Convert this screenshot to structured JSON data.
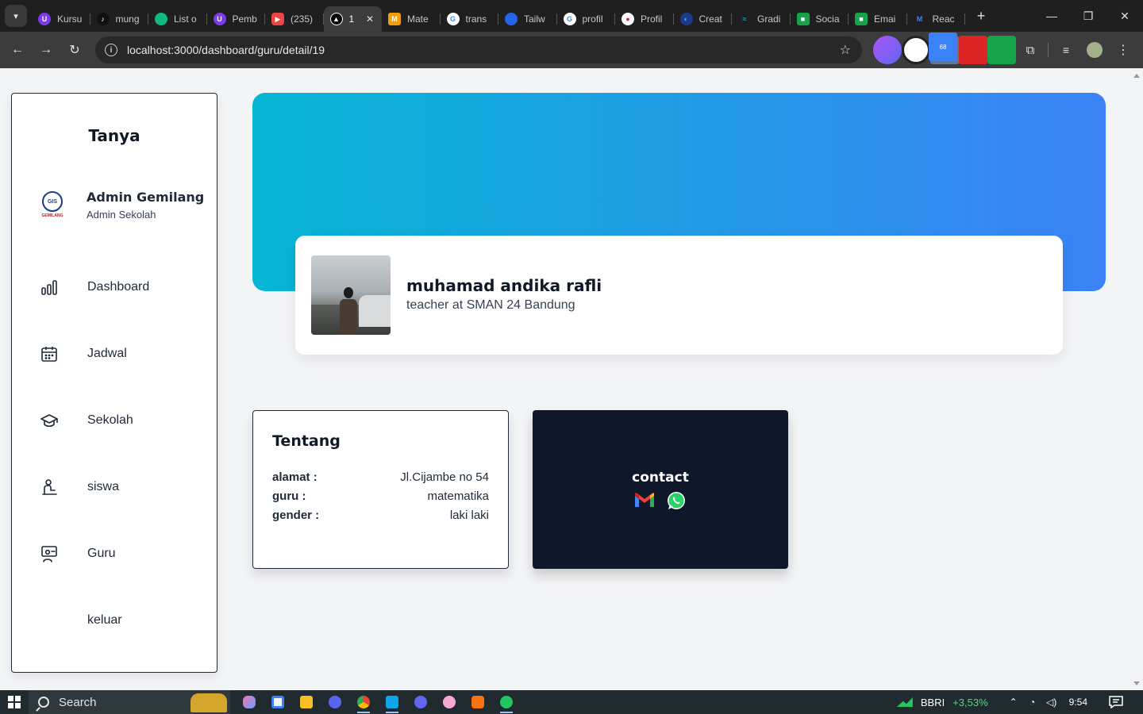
{
  "browser": {
    "tabs": [
      {
        "title": "Kursu",
        "favicon_color": "#7c3aed",
        "active": false
      },
      {
        "title": "mung",
        "favicon_color": "#111111",
        "active": false
      },
      {
        "title": "List o",
        "favicon_color": "#10b981",
        "active": false
      },
      {
        "title": "Pemb",
        "favicon_color": "#7c3aed",
        "active": false
      },
      {
        "title": "(235)",
        "favicon_color": "#ef4444",
        "active": false
      },
      {
        "title": "1",
        "favicon_color": "#000000",
        "active": true
      },
      {
        "title": "Mate",
        "favicon_color": "#f59e0b",
        "active": false
      },
      {
        "title": "trans",
        "favicon_color": "#4285f4",
        "active": false
      },
      {
        "title": "Tailw",
        "favicon_color": "#2563eb",
        "active": false
      },
      {
        "title": "profil",
        "favicon_color": "#4285f4",
        "active": false
      },
      {
        "title": "Profil",
        "favicon_color": "#e11d48",
        "active": false
      },
      {
        "title": "Creat",
        "favicon_color": "#38bdf8",
        "active": false
      },
      {
        "title": "Gradi",
        "favicon_color": "#06b6d4",
        "active": false
      },
      {
        "title": "Socia",
        "favicon_color": "#16a34a",
        "active": false
      },
      {
        "title": "Emai",
        "favicon_color": "#16a34a",
        "active": false
      },
      {
        "title": "Reac",
        "favicon_color": "#3b82f6",
        "active": false
      }
    ],
    "url": "localhost:3000/dashboard/guru/detail/19",
    "extension_badge": "68"
  },
  "sidebar": {
    "brand": "Tanya",
    "profile": {
      "name": "Admin Gemilang",
      "role": "Admin Sekolah",
      "logo_text": "GIS",
      "logo_caption": "GEMILANG"
    },
    "items": [
      {
        "label": "Dashboard",
        "icon": "bar-chart-icon"
      },
      {
        "label": "Jadwal",
        "icon": "calendar-icon"
      },
      {
        "label": "Sekolah",
        "icon": "graduation-cap-icon"
      },
      {
        "label": "siswa",
        "icon": "student-icon"
      },
      {
        "label": "Guru",
        "icon": "teacher-icon"
      },
      {
        "label": "keluar",
        "icon": ""
      }
    ]
  },
  "teacher": {
    "name": "muhamad andika rafli",
    "subtitle": "teacher at SMAN 24 Bandung"
  },
  "about": {
    "title": "Tentang",
    "rows": [
      {
        "key": "alamat :",
        "value": "Jl.Cijambe no 54"
      },
      {
        "key": "guru :",
        "value": "matematika"
      },
      {
        "key": "gender :",
        "value": "laki laki"
      }
    ]
  },
  "contact": {
    "title": "contact",
    "icons": [
      "gmail-icon",
      "whatsapp-icon"
    ]
  },
  "colors": {
    "banner_start": "#06b6d4",
    "banner_end": "#3b82f6",
    "contact_bg": "#0f172a"
  },
  "taskbar": {
    "search_label": "Search",
    "stock_name": "BBRI",
    "stock_change": "+3,53%",
    "time": "9:54"
  }
}
